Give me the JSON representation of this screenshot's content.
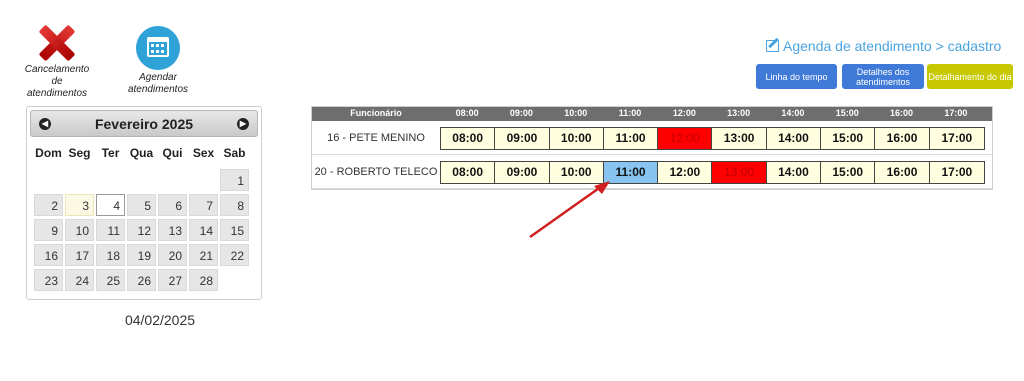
{
  "actions": {
    "cancel_label": "Cancelamento de atendimentos",
    "schedule_label": "Agendar atendimentos"
  },
  "calendar": {
    "month_label": "Fevereiro 2025",
    "days_of_week": [
      "Dom",
      "Seg",
      "Ter",
      "Qua",
      "Qui",
      "Sex",
      "Sab"
    ],
    "days": [
      "",
      "",
      "",
      "",
      "",
      "",
      "1",
      "2",
      "3",
      "4",
      "5",
      "6",
      "7",
      "8",
      "9",
      "10",
      "11",
      "12",
      "13",
      "14",
      "15",
      "16",
      "17",
      "18",
      "19",
      "20",
      "21",
      "22",
      "23",
      "24",
      "25",
      "26",
      "27",
      "28",
      ""
    ],
    "highlight_day": "3",
    "today_day": "4",
    "selected_date": "04/02/2025"
  },
  "header": {
    "title": "Agenda de atendimento > cadastro",
    "buttons": {
      "linha": "Linha do tempo",
      "detalhes": "Detalhes dos atendimentos",
      "detalhamento": "Detalhamento do dia"
    }
  },
  "schedule": {
    "employee_header": "Funcionário",
    "hours": [
      "08:00",
      "09:00",
      "10:00",
      "11:00",
      "12:00",
      "13:00",
      "14:00",
      "15:00",
      "16:00",
      "17:00"
    ],
    "rows": [
      {
        "employee": "16 - PETE MENINO",
        "busy": [
          "12:00"
        ],
        "selected": []
      },
      {
        "employee": "20 - ROBERTO TELECO",
        "busy": [
          "13:00"
        ],
        "selected": [
          "11:00"
        ]
      }
    ]
  },
  "colors": {
    "busy": "#ff0000",
    "selected": "#87c5f0",
    "free": "#ffffe0",
    "accent": "#3f7ad8",
    "arrow": "#d11f1f"
  }
}
